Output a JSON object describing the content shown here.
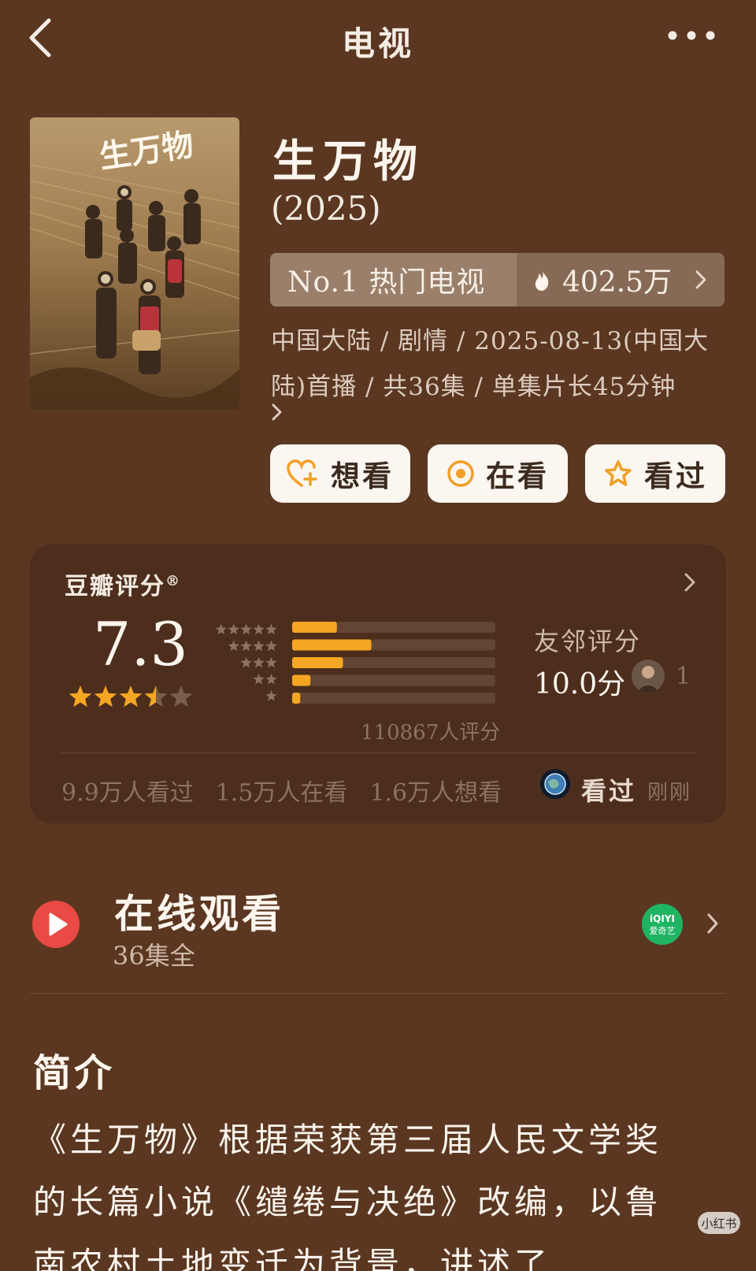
{
  "nav": {
    "title": "电视",
    "back_icon": "chevron-left-icon",
    "more_icon": "more-horizontal-icon"
  },
  "show": {
    "title": "生万物",
    "year": "(2025)",
    "poster_title": "生万物",
    "rank_label": "No.1 热门电视",
    "heat": "402.5万",
    "meta_line1": "中国大陆 / 剧情 / 2025-08-13(中国大",
    "meta_line2": "陆)首播 / 共36集 / 单集片长45分钟"
  },
  "actions": [
    {
      "label": "想看",
      "icon": "heart-plus-icon"
    },
    {
      "label": "在看",
      "icon": "target-circle-icon"
    },
    {
      "label": "看过",
      "icon": "star-outline-icon"
    }
  ],
  "rating": {
    "title": "豆瓣评分",
    "registered_mark": "®",
    "score": "7.3",
    "stars_value": 3.5,
    "distribution": [
      {
        "stars": 5,
        "fraction": 0.22
      },
      {
        "stars": 4,
        "fraction": 0.39
      },
      {
        "stars": 3,
        "fraction": 0.25
      },
      {
        "stars": 2,
        "fraction": 0.09
      },
      {
        "stars": 1,
        "fraction": 0.04
      }
    ],
    "count_text": "110867人评分",
    "neighbor_label": "友邻评分",
    "neighbor_score": "10.0分",
    "neighbor_count": "1",
    "stats": [
      "9.9万人看过",
      "1.5万人在看",
      "1.6万人想看"
    ],
    "watched_label": "看过",
    "watched_time": "刚刚",
    "colors": {
      "bar_fill": "#f5a623",
      "bar_track": "#624533",
      "star_fill": "#f5a623",
      "star_empty": "#7a5e4b"
    }
  },
  "online": {
    "title": "在线观看",
    "subtitle": "36集全",
    "platform_logo_text": "iQIYI",
    "platform_name": "爱奇艺"
  },
  "intro": {
    "title": "简介",
    "line1": "《生万物》根据荣获第三届人民文学奖",
    "line2": "的长篇小说《缱绻与决绝》改编，以鲁",
    "line3": "南农村土地变迁为背景，讲述了"
  },
  "watermark": "小红书"
}
